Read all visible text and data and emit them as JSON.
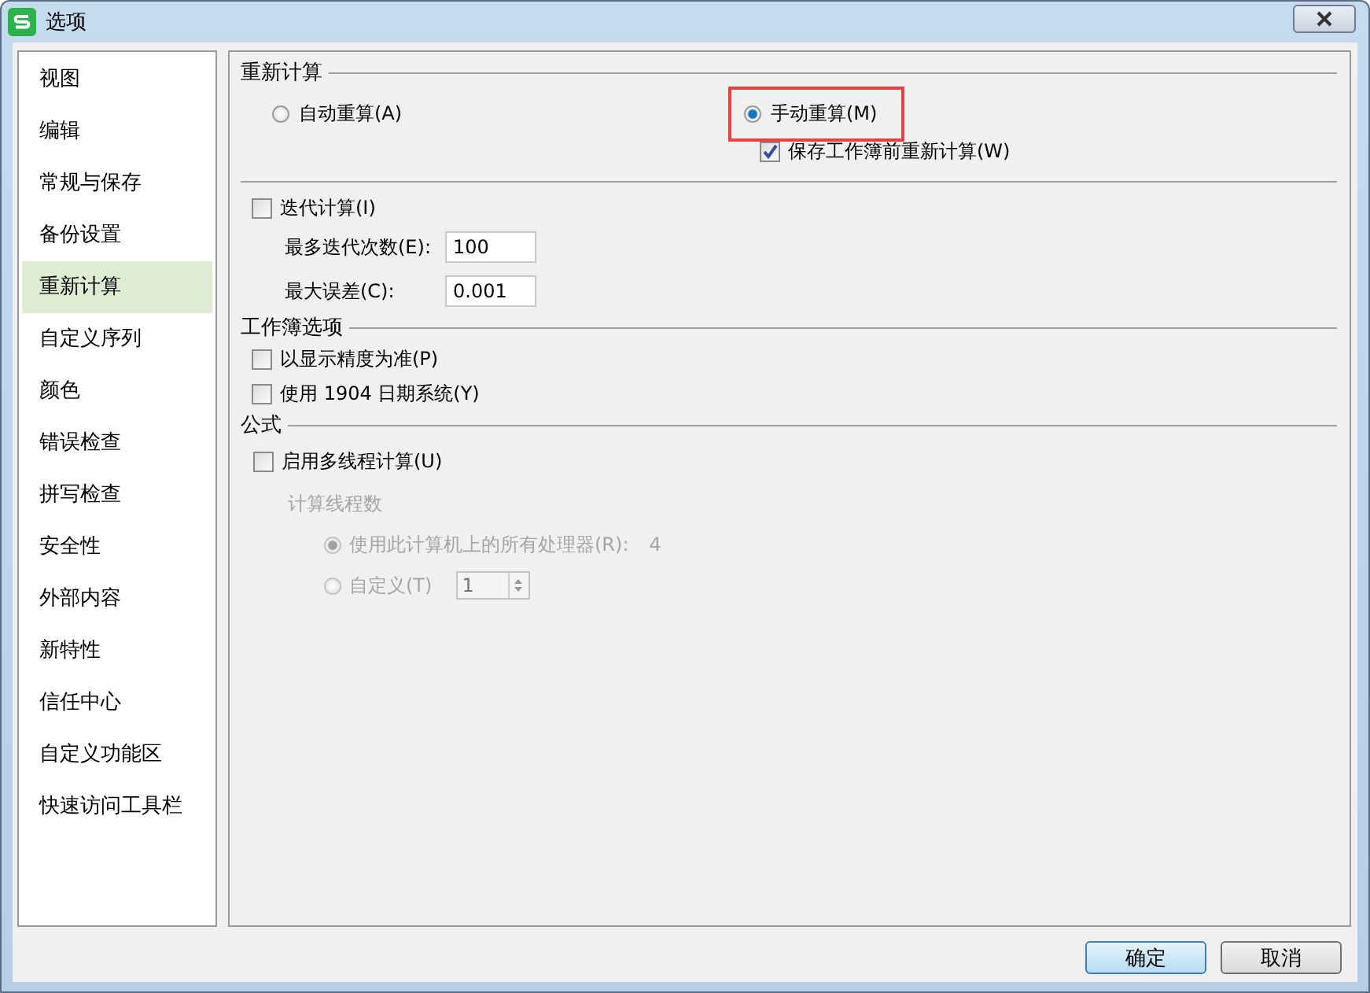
{
  "window": {
    "title": "选项"
  },
  "sidebar": {
    "items": [
      {
        "label": "视图",
        "selected": false
      },
      {
        "label": "编辑",
        "selected": false
      },
      {
        "label": "常规与保存",
        "selected": false
      },
      {
        "label": "备份设置",
        "selected": false
      },
      {
        "label": "重新计算",
        "selected": true
      },
      {
        "label": "自定义序列",
        "selected": false
      },
      {
        "label": "颜色",
        "selected": false
      },
      {
        "label": "错误检查",
        "selected": false
      },
      {
        "label": "拼写检查",
        "selected": false
      },
      {
        "label": "安全性",
        "selected": false
      },
      {
        "label": "外部内容",
        "selected": false
      },
      {
        "label": "新特性",
        "selected": false
      },
      {
        "label": "信任中心",
        "selected": false
      },
      {
        "label": "自定义功能区",
        "selected": false
      },
      {
        "label": "快速访问工具栏",
        "selected": false
      }
    ]
  },
  "recalc": {
    "title": "重新计算",
    "modes": [
      {
        "label": "自动重算(A)",
        "selected": false,
        "highlighted": false
      },
      {
        "label": "手动重算(M)",
        "selected": true,
        "highlighted": true
      }
    ],
    "save_option": {
      "label": "保存工作簿前重新计算(W)",
      "checked": true
    },
    "iteration": {
      "label": "迭代计算(I)",
      "checked": false
    },
    "fields": [
      {
        "label": "最多迭代次数(E):",
        "value": "100"
      },
      {
        "label": "最大误差(C):",
        "value": "0.001"
      }
    ]
  },
  "workbook": {
    "title": "工作簿选项",
    "options": [
      {
        "label": "以显示精度为准(P)",
        "checked": false
      },
      {
        "label": "使用 1904 日期系统(Y)",
        "checked": false
      }
    ]
  },
  "formula": {
    "title": "公式",
    "multithread": {
      "label": "启用多线程计算(U)",
      "checked": false
    },
    "threads_title": "计算线程数",
    "thread_options": [
      {
        "kind": "all",
        "label": "使用此计算机上的所有处理器(R):",
        "value": "4",
        "selected": true
      },
      {
        "kind": "custom",
        "label": "自定义(T)",
        "value": "1",
        "selected": false
      }
    ]
  },
  "buttons": [
    {
      "label": "确定",
      "default": true
    },
    {
      "label": "取消",
      "default": false
    }
  ]
}
